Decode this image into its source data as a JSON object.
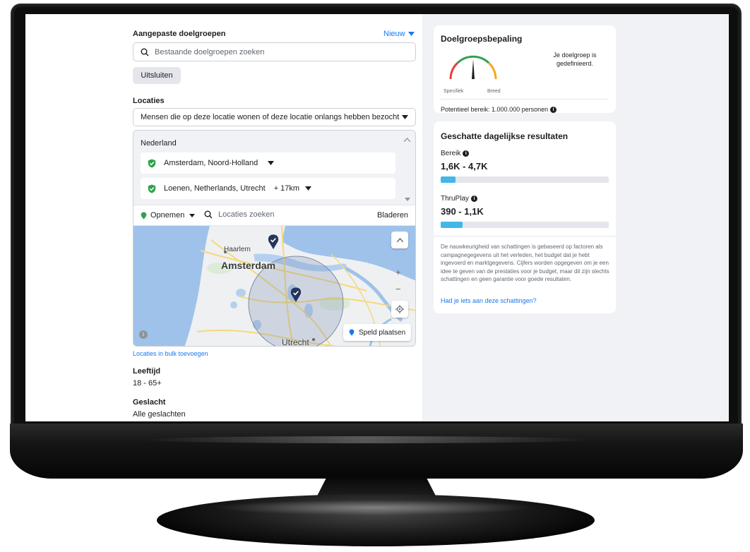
{
  "targeting": {
    "custom_audiences": {
      "label": "Aangepaste doelgroepen",
      "new_label": "Nieuw",
      "search_placeholder": "Bestaande doelgroepen zoeken",
      "exclude_label": "Uitsluiten"
    },
    "locations": {
      "label": "Locaties",
      "mode_value": "Mensen die op deze locatie wonen of deze locatie onlangs hebben bezocht",
      "country": "Nederland",
      "items": [
        {
          "name": "Amsterdam, Noord-Holland",
          "radius": ""
        },
        {
          "name": "Loenen, Netherlands, Utrecht",
          "radius": "+ 17km"
        }
      ],
      "include_label": "Opnemen",
      "search_placeholder": "Locaties zoeken",
      "browse_label": "Bladeren",
      "map_labels": {
        "haarlem": "Haarlem",
        "amsterdam": "Amsterdam",
        "utrecht": "Utrecht"
      },
      "drop_pin_label": "Speld plaatsen",
      "bulk_add_link": "Locaties in bulk toevoegen"
    },
    "age": {
      "label": "Leeftijd",
      "value": "18 - 65+"
    },
    "gender": {
      "label": "Geslacht",
      "value": "Alle geslachten"
    }
  },
  "audience_definition": {
    "title": "Doelgroepsbepaling",
    "gauge_left": "Specifiek",
    "gauge_right": "Breed",
    "gauge_level": 0.5,
    "status_text": "Je doelgroep is gedefinieerd.",
    "potential_reach": "Potentieel bereik: 1.000.000 personen"
  },
  "estimated_results": {
    "title": "Geschatte dagelijkse resultaten",
    "reach_label": "Bereik",
    "reach_value": "1,6K - 4,7K",
    "reach_fill": 0.09,
    "thruplay_label": "ThruPlay",
    "thruplay_value": "390 - 1,1K",
    "thruplay_fill": 0.13,
    "disclaimer": "De nauwkeurigheid van schattingen is gebaseerd op factoren als campagnegegevens uit het verleden, het budget dat je hebt ingevoerd en marktgegevens. Cijfers worden opgegeven om je een idee te geven van de prestaties voor je budget, maar dit zijn slechts schattingen en geen garantie voor goede resultaten.",
    "feedback_link": "Had je iets aan deze schattingen?"
  },
  "colors": {
    "accent": "#1877f2",
    "bar_fill": "#42b7e8",
    "check_green": "#31a24c",
    "map_water": "#9fc2ea",
    "map_land": "#eef0f2"
  }
}
